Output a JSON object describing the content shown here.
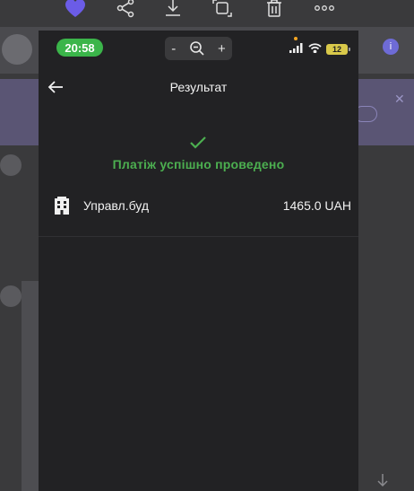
{
  "viewer": {
    "toolbar": [
      "heart-icon",
      "share-icon",
      "download-icon",
      "crop-icon",
      "trash-icon",
      "more-icon"
    ],
    "accent": "#6b5ce7"
  },
  "background": {
    "banner_close": "✕",
    "info_icon": "i"
  },
  "phone": {
    "status": {
      "time": "20:58",
      "battery": "12",
      "time_pill_color": "#3bb54a"
    },
    "zoom": {
      "minus": "-",
      "plus": "+"
    },
    "nav": {
      "title": "Результат"
    },
    "result": {
      "message": "Платіж успішно проведено",
      "color": "#4caf50"
    },
    "payment": {
      "name": "Управл.буд",
      "amount": "1465.0 UAH"
    }
  }
}
